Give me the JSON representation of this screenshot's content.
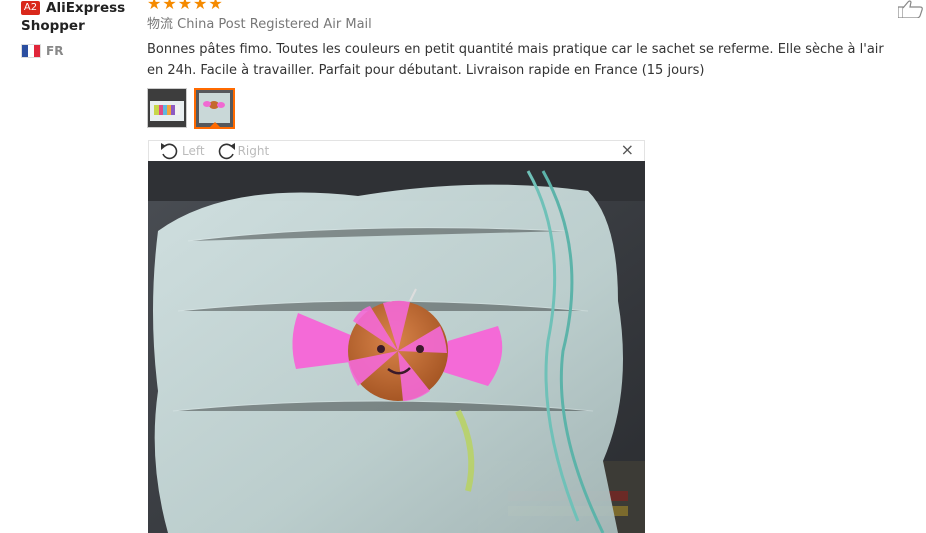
{
  "reviewer": {
    "badge": "A2",
    "name_line1": "AliExpress",
    "name_line2": "Shopper",
    "country_code": "FR",
    "flag_colors": [
      "#2b4ea0",
      "#ffffff",
      "#e0263a"
    ]
  },
  "review": {
    "rating": 5,
    "stars": [
      "★",
      "★",
      "★",
      "★",
      "★"
    ],
    "shipping_label": "物流",
    "shipping_method": "China Post Registered Air Mail",
    "text": "Bonnes pâtes fimo. Toutes les couleurs en petit quantité mais pratique car le sachet se referme. Elle sèche à l'air en 24h. Facile à travailler. Parfait pour débutant. Livraison rapide en France (15 jours)"
  },
  "viewer": {
    "rotate_left_label": "Left",
    "rotate_right_label": "Right",
    "close_symbol": "×"
  },
  "colors": {
    "star": "#f58a00",
    "accent": "#ff6a00",
    "badge": "#d9281b"
  }
}
